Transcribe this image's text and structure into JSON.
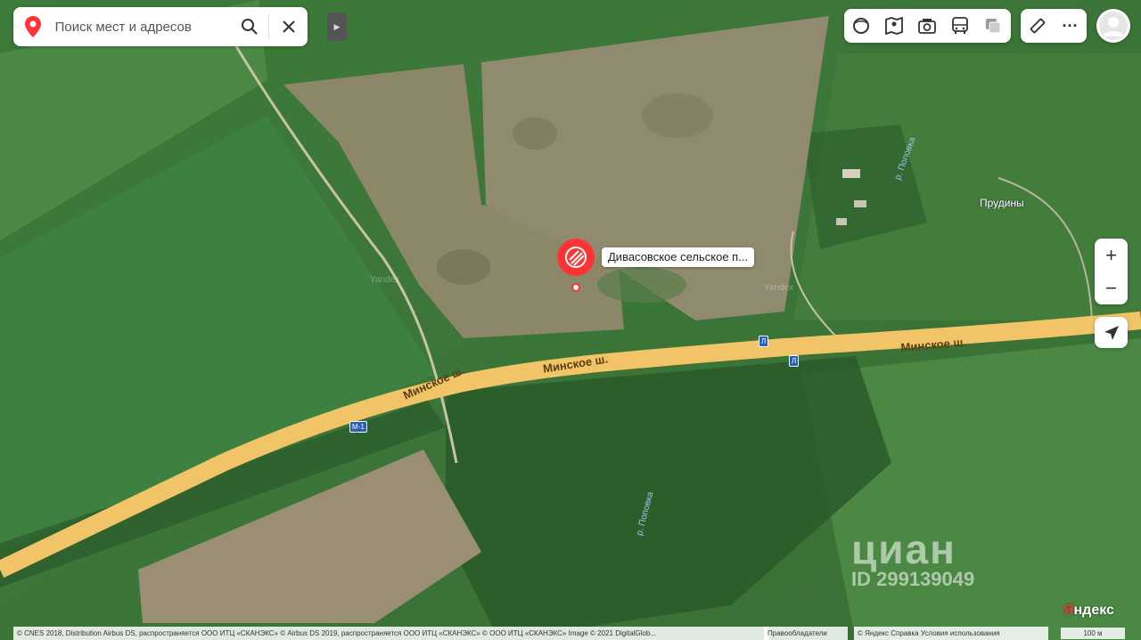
{
  "search": {
    "placeholder": "Поиск мест и адресов"
  },
  "icons": {
    "location": "location-pin-icon",
    "search": "search-icon",
    "close": "close-icon",
    "collapse": "collapse-panel-icon",
    "layers": "layers-icon",
    "panorama": "panorama-icon",
    "photo": "photo-icon",
    "transport": "bus-icon",
    "traffic": "traffic-icon",
    "ruler": "ruler-icon",
    "more": "more-icon",
    "profile": "profile-icon",
    "zoom_in": "zoom-in-icon",
    "zoom_out": "zoom-out-icon",
    "locate": "geolocation-icon",
    "marker": "place-marker-icon"
  },
  "zoom": {
    "plus": "+",
    "minus": "−"
  },
  "more": {
    "label": "···"
  },
  "place": {
    "name": "Дивасовское сельское п..."
  },
  "map_labels": {
    "village": "Прудины",
    "road_1": "Минское ш.",
    "road_2": "Минское ш.",
    "road_3": "Минское ш.",
    "river_1": "р. Поповка",
    "river_2": "р. Поповка",
    "route_m1": "М-1",
    "route_a": "Л",
    "watermark_1": "Yandex",
    "watermark_2": "Yandex"
  },
  "cian": {
    "brand": "циан",
    "id": "ID 299139049"
  },
  "yandex_logo": {
    "first": "Я",
    "rest": "ндекс"
  },
  "footer": {
    "copyright": "© CNES 2018, Distribution Airbus DS, распространяется ООО ИТЦ «СКАНЭКС» © Airbus DS 2019, распространяется ООО ИТЦ «СКАНЭКС» © ООО ИТЦ «СКАНЭКС» Image © 2021 DigitalGlob...",
    "rights": "Правообладатели",
    "links": "© Яндекс   Справка   Условия использования",
    "scale": "100 м"
  },
  "colors": {
    "road": "#f2c468",
    "accent": "#ff3333",
    "grass": "#3f7a3c",
    "field": "#8f8a6e"
  }
}
